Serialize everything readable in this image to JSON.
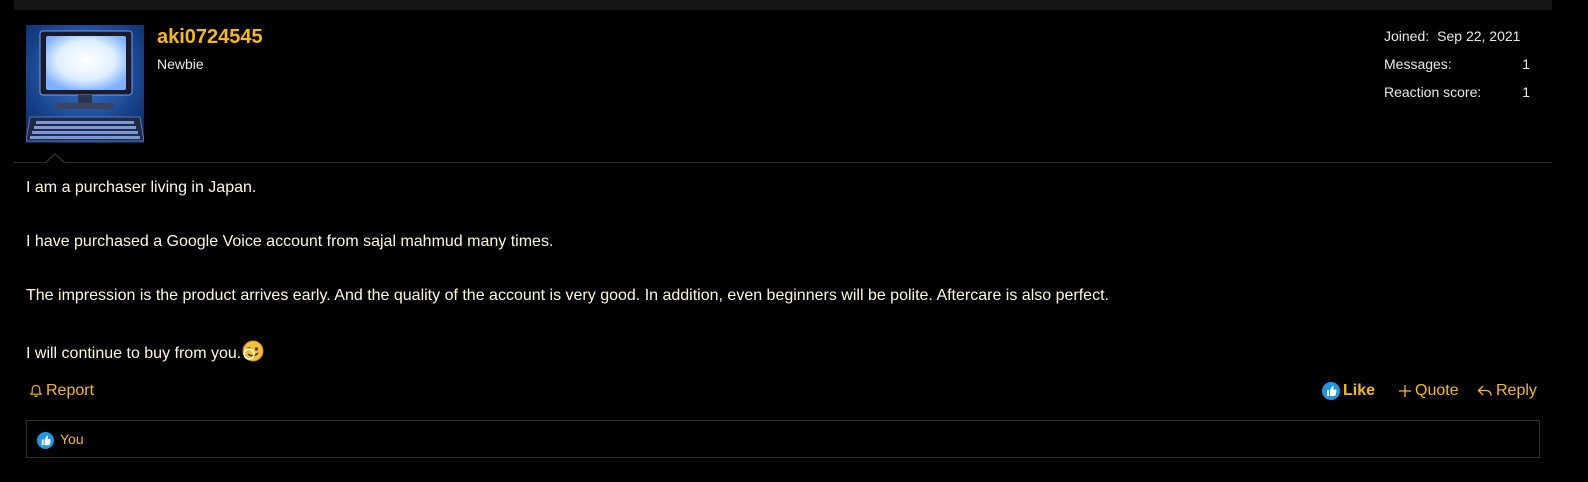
{
  "user": {
    "name": "aki0724545",
    "title": "Newbie",
    "avatar_icon": "computer-monitor-avatar"
  },
  "stats": {
    "joined_label": "Joined:",
    "joined_value": "Sep 22, 2021",
    "messages_label": "Messages:",
    "messages_value": "1",
    "reaction_label": "Reaction score:",
    "reaction_value": "1"
  },
  "message": {
    "paragraphs": [
      "I am a purchaser living in Japan.",
      "I have purchased a Google Voice account from sajal mahmud many times.",
      "The impression is the product arrives early. And the quality of the account is very good. In addition, even beginners will be polite. Aftercare is also perfect.",
      "I will continue to buy from you."
    ],
    "emoji": "wink-face-icon"
  },
  "actions": {
    "report": "Report",
    "like": "Like",
    "quote": "Quote",
    "reply": "Reply"
  },
  "reactions": {
    "users": "You"
  },
  "colors": {
    "accent": "#f5bc0a",
    "background": "#000000",
    "text": "#fff8dc",
    "like_blue": "#2196e3"
  }
}
